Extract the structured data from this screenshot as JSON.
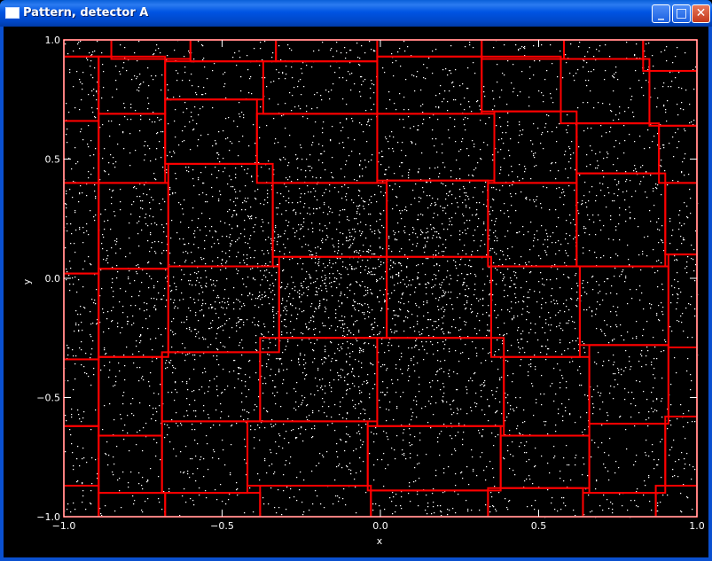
{
  "window": {
    "title": "Pattern, detector A",
    "buttons": {
      "minimize": "_",
      "maximize": "□",
      "close": "✕"
    }
  },
  "colors": {
    "background": "#000000",
    "points": "#ffffff",
    "boxes": "#ff0000",
    "axes": "#ffffff"
  },
  "chart_data": {
    "type": "scatter",
    "title": "",
    "xlabel": "x",
    "ylabel": "y",
    "xlim": [
      -1.0,
      1.0
    ],
    "ylim": [
      -1.0,
      1.0
    ],
    "xticks": [
      -1.0,
      -0.5,
      0.0,
      0.5,
      1.0
    ],
    "yticks": [
      -1.0,
      -0.5,
      0.0,
      0.5,
      1.0
    ],
    "xtick_labels": [
      "−1.0",
      "−0.5",
      "0.0",
      "0.5",
      "1.0"
    ],
    "ytick_labels": [
      "−1.0",
      "−0.5",
      "0.0",
      "0.5",
      "1.0"
    ],
    "grid": false,
    "series": [
      {
        "distribution": "gaussian",
        "center": [
          -0.07,
          0.0
        ],
        "sigma": [
          0.42,
          0.32
        ],
        "density_peak": "center"
      }
    ],
    "boxes": [
      {
        "x": [
          -1.0,
          -0.85
        ],
        "y": [
          0.93,
          1.0
        ]
      },
      {
        "x": [
          -0.85,
          -0.6
        ],
        "y": [
          0.92,
          1.0
        ]
      },
      {
        "x": [
          -0.6,
          -0.33
        ],
        "y": [
          0.91,
          1.0
        ]
      },
      {
        "x": [
          -0.33,
          -0.01
        ],
        "y": [
          0.91,
          1.0
        ]
      },
      {
        "x": [
          -0.01,
          0.32
        ],
        "y": [
          0.93,
          1.0
        ]
      },
      {
        "x": [
          0.32,
          0.58
        ],
        "y": [
          0.92,
          1.0
        ]
      },
      {
        "x": [
          0.58,
          0.83
        ],
        "y": [
          0.92,
          1.0
        ]
      },
      {
        "x": [
          0.83,
          1.0
        ],
        "y": [
          0.87,
          1.0
        ]
      },
      {
        "x": [
          -1.0,
          -0.89
        ],
        "y": [
          0.66,
          0.93
        ]
      },
      {
        "x": [
          -0.89,
          -0.68
        ],
        "y": [
          0.69,
          0.93
        ]
      },
      {
        "x": [
          -0.68,
          -0.37
        ],
        "y": [
          0.75,
          0.91
        ]
      },
      {
        "x": [
          -0.37,
          -0.01
        ],
        "y": [
          0.69,
          0.91
        ]
      },
      {
        "x": [
          -0.01,
          0.32
        ],
        "y": [
          0.69,
          0.93
        ]
      },
      {
        "x": [
          0.32,
          0.57
        ],
        "y": [
          0.7,
          0.93
        ]
      },
      {
        "x": [
          0.57,
          0.85
        ],
        "y": [
          0.65,
          0.92
        ]
      },
      {
        "x": [
          0.85,
          1.0
        ],
        "y": [
          0.64,
          0.87
        ]
      },
      {
        "x": [
          -1.0,
          -0.89
        ],
        "y": [
          0.4,
          0.66
        ]
      },
      {
        "x": [
          -0.89,
          -0.68
        ],
        "y": [
          0.4,
          0.69
        ]
      },
      {
        "x": [
          -0.68,
          -0.39
        ],
        "y": [
          0.48,
          0.75
        ]
      },
      {
        "x": [
          -0.39,
          -0.01
        ],
        "y": [
          0.4,
          0.69
        ]
      },
      {
        "x": [
          -0.01,
          0.36
        ],
        "y": [
          0.41,
          0.69
        ]
      },
      {
        "x": [
          0.36,
          0.62
        ],
        "y": [
          0.4,
          0.7
        ]
      },
      {
        "x": [
          0.62,
          0.88
        ],
        "y": [
          0.44,
          0.65
        ]
      },
      {
        "x": [
          0.88,
          1.0
        ],
        "y": [
          0.4,
          0.64
        ]
      },
      {
        "x": [
          -1.0,
          -0.89
        ],
        "y": [
          0.02,
          0.4
        ]
      },
      {
        "x": [
          -0.89,
          -0.67
        ],
        "y": [
          0.04,
          0.4
        ]
      },
      {
        "x": [
          -0.67,
          -0.34
        ],
        "y": [
          0.05,
          0.48
        ]
      },
      {
        "x": [
          -0.34,
          0.02
        ],
        "y": [
          0.09,
          0.4
        ]
      },
      {
        "x": [
          0.02,
          0.34
        ],
        "y": [
          0.09,
          0.41
        ]
      },
      {
        "x": [
          0.34,
          0.62
        ],
        "y": [
          0.05,
          0.4
        ]
      },
      {
        "x": [
          0.62,
          0.9
        ],
        "y": [
          0.05,
          0.44
        ]
      },
      {
        "x": [
          0.9,
          1.0
        ],
        "y": [
          0.1,
          0.4
        ]
      },
      {
        "x": [
          -1.0,
          -0.89
        ],
        "y": [
          -0.34,
          0.02
        ]
      },
      {
        "x": [
          -0.89,
          -0.67
        ],
        "y": [
          -0.33,
          0.04
        ]
      },
      {
        "x": [
          -0.67,
          -0.32
        ],
        "y": [
          -0.31,
          0.05
        ]
      },
      {
        "x": [
          -0.32,
          0.02
        ],
        "y": [
          -0.25,
          0.09
        ]
      },
      {
        "x": [
          0.02,
          0.35
        ],
        "y": [
          -0.25,
          0.09
        ]
      },
      {
        "x": [
          0.35,
          0.63
        ],
        "y": [
          -0.33,
          0.05
        ]
      },
      {
        "x": [
          0.63,
          0.91
        ],
        "y": [
          -0.28,
          0.05
        ]
      },
      {
        "x": [
          0.91,
          1.0
        ],
        "y": [
          -0.29,
          0.1
        ]
      },
      {
        "x": [
          -1.0,
          -0.89
        ],
        "y": [
          -0.62,
          -0.34
        ]
      },
      {
        "x": [
          -0.89,
          -0.69
        ],
        "y": [
          -0.66,
          -0.33
        ]
      },
      {
        "x": [
          -0.69,
          -0.38
        ],
        "y": [
          -0.6,
          -0.31
        ]
      },
      {
        "x": [
          -0.38,
          -0.01
        ],
        "y": [
          -0.6,
          -0.25
        ]
      },
      {
        "x": [
          -0.01,
          0.39
        ],
        "y": [
          -0.62,
          -0.25
        ]
      },
      {
        "x": [
          0.39,
          0.66
        ],
        "y": [
          -0.66,
          -0.33
        ]
      },
      {
        "x": [
          0.66,
          0.91
        ],
        "y": [
          -0.61,
          -0.28
        ]
      },
      {
        "x": [
          0.91,
          1.0
        ],
        "y": [
          -0.58,
          -0.29
        ]
      },
      {
        "x": [
          -1.0,
          -0.89
        ],
        "y": [
          -0.87,
          -0.62
        ]
      },
      {
        "x": [
          -0.89,
          -0.69
        ],
        "y": [
          -0.9,
          -0.66
        ]
      },
      {
        "x": [
          -0.69,
          -0.42
        ],
        "y": [
          -0.9,
          -0.6
        ]
      },
      {
        "x": [
          -0.42,
          -0.04
        ],
        "y": [
          -0.87,
          -0.6
        ]
      },
      {
        "x": [
          -0.04,
          0.38
        ],
        "y": [
          -0.89,
          -0.62
        ]
      },
      {
        "x": [
          0.38,
          0.66
        ],
        "y": [
          -0.88,
          -0.66
        ]
      },
      {
        "x": [
          0.66,
          0.9
        ],
        "y": [
          -0.9,
          -0.61
        ]
      },
      {
        "x": [
          0.9,
          1.0
        ],
        "y": [
          -0.87,
          -0.58
        ]
      },
      {
        "x": [
          -1.0,
          -0.89
        ],
        "y": [
          -1.0,
          -0.87
        ]
      },
      {
        "x": [
          -0.89,
          -0.68
        ],
        "y": [
          -1.0,
          -0.9
        ]
      },
      {
        "x": [
          -0.68,
          -0.38
        ],
        "y": [
          -1.0,
          -0.9
        ]
      },
      {
        "x": [
          -0.38,
          -0.03
        ],
        "y": [
          -1.0,
          -0.87
        ]
      },
      {
        "x": [
          -0.03,
          0.34
        ],
        "y": [
          -1.0,
          -0.89
        ]
      },
      {
        "x": [
          0.34,
          0.64
        ],
        "y": [
          -1.0,
          -0.88
        ]
      },
      {
        "x": [
          0.64,
          0.87
        ],
        "y": [
          -1.0,
          -0.9
        ]
      },
      {
        "x": [
          0.87,
          1.0
        ],
        "y": [
          -1.0,
          -0.87
        ]
      }
    ]
  }
}
